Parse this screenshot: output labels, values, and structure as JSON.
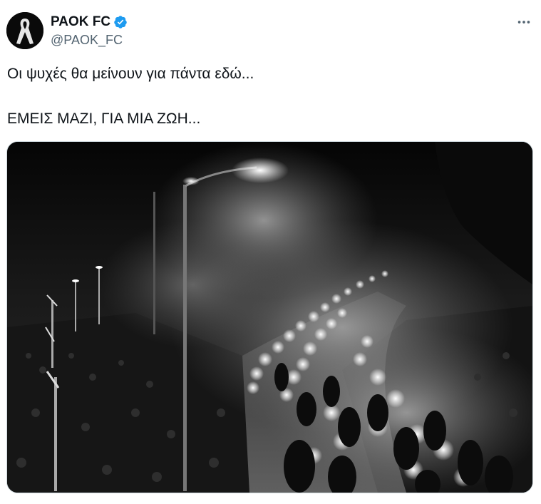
{
  "tweet": {
    "author": {
      "display_name": "PAOK FC",
      "handle": "@PAOK_FC",
      "verified": true,
      "avatar_icon": "black-ribbon-icon"
    },
    "more_icon": "more-horizontal-icon",
    "text_lines": [
      "Οι ψυχές θα μείνουν για πάντα εδώ...",
      "ΕΜΕΙΣ ΜΑΖΙ, ΓΙΑ ΜΙΑ ΖΩΗ..."
    ],
    "media": {
      "type": "photo",
      "style": "black-and-white"
    }
  },
  "colors": {
    "text": "#0f1419",
    "secondary_text": "#536471",
    "verified_blue": "#1d9bf0",
    "border": "#cfd9de"
  }
}
